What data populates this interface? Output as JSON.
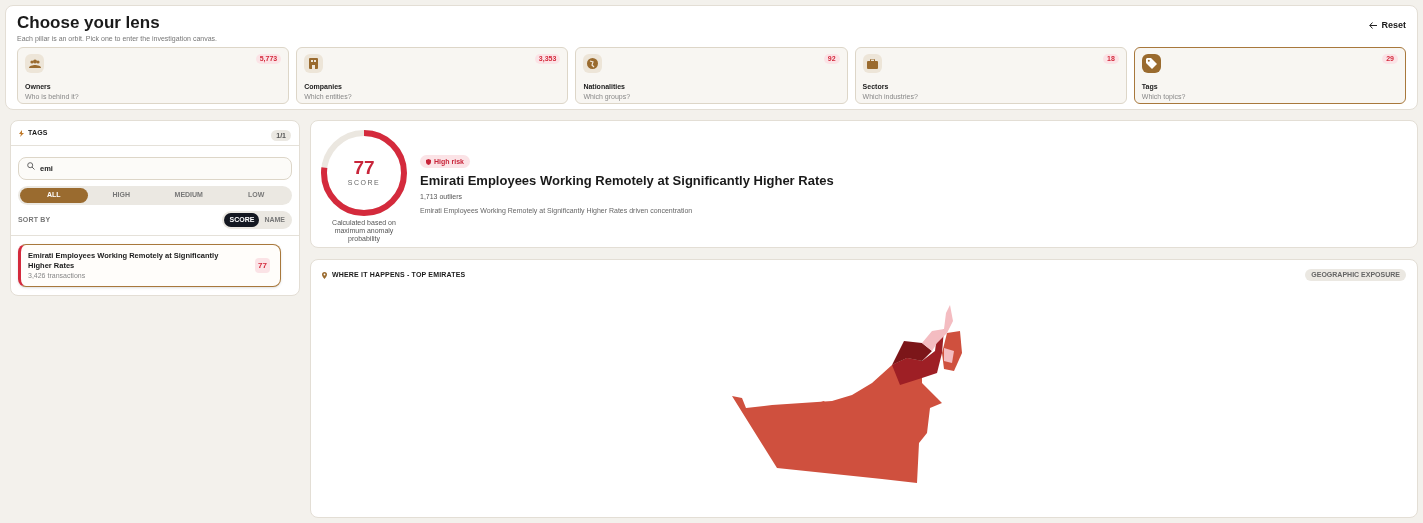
{
  "header": {
    "title": "Choose your lens",
    "subtitle": "Each pillar is an orbit. Pick one to enter the investigation canvas.",
    "reset": "Reset"
  },
  "pillars": [
    {
      "kind": "owners",
      "label": "Owners",
      "hint": "Who is behind it?",
      "count": "5,773",
      "selected": false
    },
    {
      "kind": "companies",
      "label": "Companies",
      "hint": "Which entities?",
      "count": "3,353",
      "selected": false
    },
    {
      "kind": "nationalities",
      "label": "Nationalities",
      "hint": "Which groups?",
      "count": "92",
      "selected": false
    },
    {
      "kind": "sectors",
      "label": "Sectors",
      "hint": "Which industries?",
      "count": "18",
      "selected": false
    },
    {
      "kind": "tags",
      "label": "Tags",
      "hint": "Which topics?",
      "count": "29",
      "selected": true
    }
  ],
  "panel": {
    "title": "TAGS",
    "page": "1/1",
    "search": {
      "value": "emi"
    },
    "filters": [
      {
        "label": "ALL",
        "selected": true
      },
      {
        "label": "HIGH",
        "selected": false
      },
      {
        "label": "MEDIUM",
        "selected": false
      },
      {
        "label": "LOW",
        "selected": false
      }
    ],
    "sort_label": "SORT BY",
    "sort": [
      {
        "label": "SCORE",
        "selected": true
      },
      {
        "label": "NAME",
        "selected": false
      }
    ],
    "items": [
      {
        "title": "Emirati Employees Working Remotely at Significantly Higher Rates",
        "meta": "3,426 transactions",
        "score": "77",
        "selected": true
      }
    ]
  },
  "detail": {
    "score": "77",
    "score_label": "SCORE",
    "score_note": "Calculated based on maximum anomaly probability",
    "risk": "High risk",
    "title": "Emirati Employees Working Remotely at Significantly Higher Rates",
    "outliers": "1,713 outliers",
    "description": "Emirati Employees Working Remotely at Significantly Higher Rates driven concentration"
  },
  "map": {
    "title": "WHERE IT HAPPENS - TOP EMIRATES",
    "badge": "GEOGRAPHIC EXPOSURE"
  }
}
